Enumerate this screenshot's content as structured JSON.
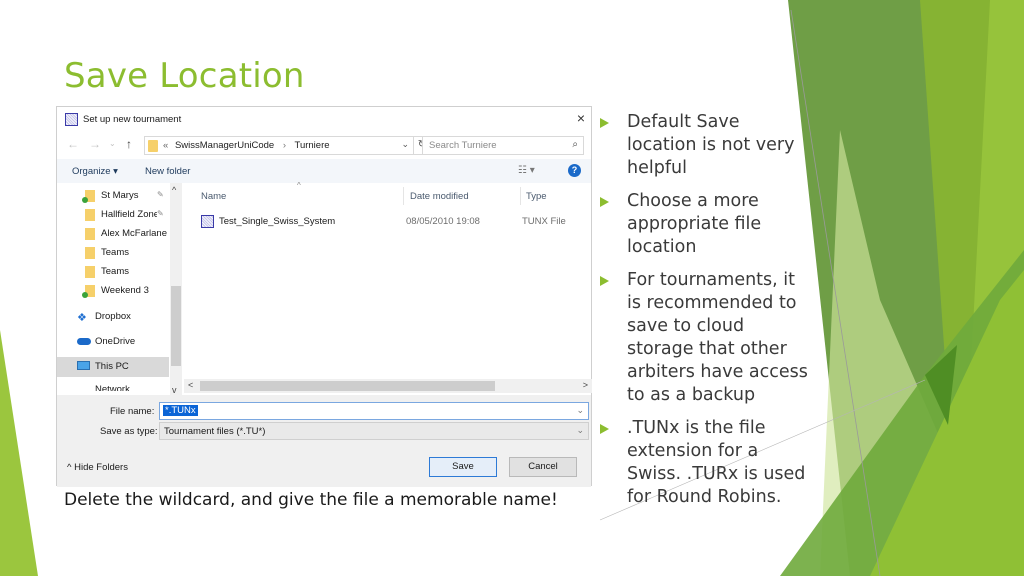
{
  "slide": {
    "title": "Save Location",
    "caption": "Delete the wildcard, and give the file a memorable name!",
    "accent_color": "#8cbd30",
    "bullets": [
      "Default Save location is not very helpful",
      "Choose a more appropriate file location",
      "For tournaments, it is recommended to save to cloud storage that other arbiters have access to as a backup",
      ".TUNx is the file extension for a Swiss. .TURx is used for Round Robins."
    ]
  },
  "dialog": {
    "title": "Set up new tournament",
    "close_icon": "×",
    "nav": {
      "back_icon": "←",
      "forward_icon": "→",
      "recent_icon": "⌄",
      "up_icon": "↑",
      "breadcrumb_prefix": "«",
      "breadcrumb": [
        "SwissManagerUniCode",
        "Turniere"
      ],
      "breadcrumb_sep": "›",
      "dropdown_icon": "⌄",
      "refresh_icon": "↻"
    },
    "search": {
      "placeholder": "Search Turniere",
      "icon": "⌕"
    },
    "toolbar": {
      "organize": "Organize ▾",
      "new_folder": "New folder",
      "view_icon": "☷ ▾",
      "help_icon": "?"
    },
    "nav_pane": {
      "items": [
        {
          "label": "St Marys",
          "pinned": true
        },
        {
          "label": "Hallfield Zone",
          "pinned": true
        },
        {
          "label": "Alex McFarlane I",
          "pinned": false
        },
        {
          "label": "Teams",
          "pinned": false
        },
        {
          "label": "Teams",
          "pinned": false
        },
        {
          "label": "Weekend 3",
          "pinned": false
        },
        {
          "label": "Dropbox"
        },
        {
          "label": "OneDrive"
        },
        {
          "label": "This PC"
        },
        {
          "label": "Network"
        }
      ],
      "pin_icon": "✎"
    },
    "file_list": {
      "columns": [
        "Name",
        "Date modified",
        "Type"
      ],
      "sort_icon": "^",
      "rows": [
        {
          "name": "Test_Single_Swiss_System",
          "date": "08/05/2010 19:08",
          "type": "TUNX File"
        }
      ]
    },
    "scroll": {
      "up": "^",
      "down": "v",
      "left": "<",
      "right": ">"
    },
    "file_name_label": "File name:",
    "file_name_value": "*.TUNx",
    "save_type_label": "Save as type:",
    "save_type_value": "Tournament files (*.TU*)",
    "hide_folders": "^  Hide Folders",
    "save_button": "Save",
    "cancel_button": "Cancel"
  }
}
